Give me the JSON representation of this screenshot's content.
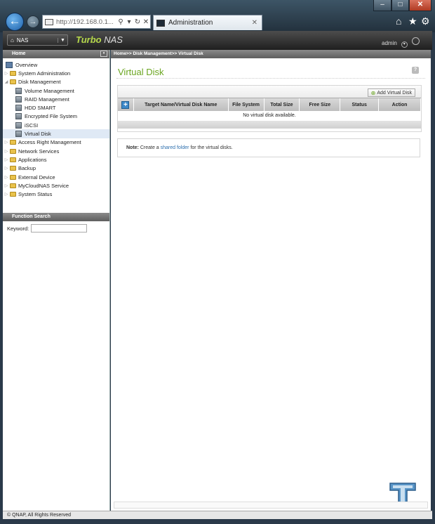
{
  "browser": {
    "url": "http://192.168.0.1...",
    "tab_title": "Administration",
    "tab_close": "✕",
    "window_controls": {
      "minimize": "–",
      "maximize": "□",
      "close": "✕"
    },
    "icons": [
      "back-icon",
      "forward-icon",
      "search-icon",
      "refresh-icon",
      "close-icon",
      "home-icon",
      "favorites-icon",
      "settings-icon"
    ]
  },
  "app": {
    "nas_button": "NAS",
    "brand": "Turbo",
    "brand_suffix": " NAS",
    "user": "admin"
  },
  "sidebar": {
    "header": "Home",
    "collapse": "«",
    "items": [
      {
        "label": "Overview"
      },
      {
        "label": "System Administration"
      },
      {
        "label": "Disk Management"
      },
      {
        "label": "Volume Management"
      },
      {
        "label": "RAID Management"
      },
      {
        "label": "HDD SMART"
      },
      {
        "label": "Encrypted File System"
      },
      {
        "label": "iSCSI"
      },
      {
        "label": "Virtual Disk"
      },
      {
        "label": "Access Right Management"
      },
      {
        "label": "Network Services"
      },
      {
        "label": "Applications"
      },
      {
        "label": "Backup"
      },
      {
        "label": "External Device"
      },
      {
        "label": "MyCloudNAS Service"
      },
      {
        "label": "System Status"
      }
    ],
    "function_search": {
      "header": "Function Search",
      "keyword_label": "Keyword:",
      "keyword_value": ""
    }
  },
  "main": {
    "breadcrumb": "Home>> Disk Management>> Virtual Disk",
    "title": "Virtual Disk",
    "help": "?",
    "add_button": "Add Virtual Disk",
    "table": {
      "add_icon": "+",
      "columns": [
        "Target Name/Virtual Disk Name",
        "File System",
        "Total Size",
        "Free Size",
        "Status",
        "Action"
      ],
      "empty_message": "No virtual disk available."
    },
    "note": {
      "label": "Note:",
      "text_before": " Create a ",
      "link": "shared folder",
      "text_after": " for the virtual disks."
    }
  },
  "footer": {
    "copyright": "© QNAP, All Rights Reserved"
  },
  "colors": {
    "accent_green": "#6aa520",
    "link_blue": "#2d6fae",
    "header_gray": "#5e5e5e"
  }
}
